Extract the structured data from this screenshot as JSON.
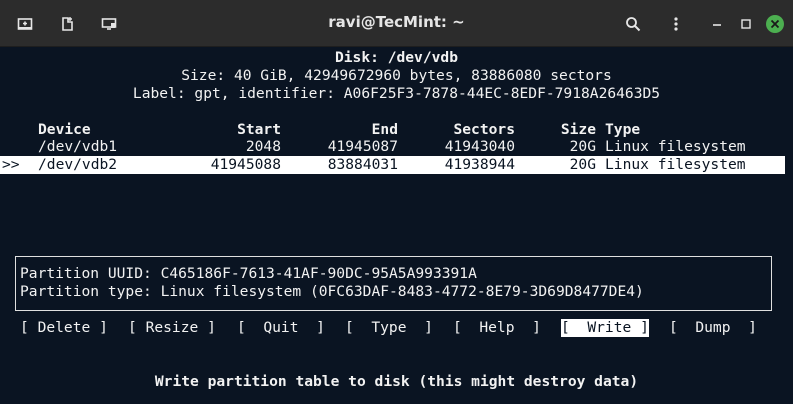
{
  "window": {
    "title": "ravi@TecMint: ~",
    "icons": [
      "new-tab-icon",
      "split-icon",
      "screen-icon",
      "search-icon",
      "kebab-menu-icon",
      "minimize-icon",
      "maximize-icon",
      "close-icon"
    ],
    "close_color": "#4caf50"
  },
  "disk": {
    "header": "Disk: /dev/vdb",
    "size_line": "Size: 40 GiB, 42949672960 bytes, 83886080 sectors",
    "label_line": "Label: gpt, identifier: A06F25F3-7878-44EC-8EDF-7918A26463D5"
  },
  "table": {
    "headers": {
      "device": "Device",
      "start": "Start",
      "end": "End",
      "sectors": "Sectors",
      "size": "Size",
      "type": "Type"
    },
    "rows": [
      {
        "marker": "",
        "device": "/dev/vdb1",
        "start": "2048",
        "end": "41945087",
        "sectors": "41943040",
        "size": "20G",
        "type": "Linux filesystem"
      },
      {
        "marker": ">>",
        "device": "/dev/vdb2",
        "start": "41945088",
        "end": "83884031",
        "sectors": "41938944",
        "size": "20G",
        "type": "Linux filesystem"
      }
    ]
  },
  "info": {
    "uuid_line": "Partition UUID: C465186F-7613-41AF-90DC-95A5A993391A",
    "type_line": "Partition type: Linux filesystem (0FC63DAF-8483-4772-8E79-3D69D8477DE4)"
  },
  "menu": {
    "delete": "[ Delete ]",
    "resize": "[ Resize ]",
    "quit": "[  Quit  ]",
    "type": "[  Type  ]",
    "help": "[  Help  ]",
    "write": "[  Write ]",
    "dump": "[  Dump  ]"
  },
  "status": "Write partition table to disk (this might destroy data)",
  "colors": {
    "terminal_bg": "#0a1422",
    "titlebar_bg": "#2c2c2c",
    "highlight": "#ffffff"
  }
}
